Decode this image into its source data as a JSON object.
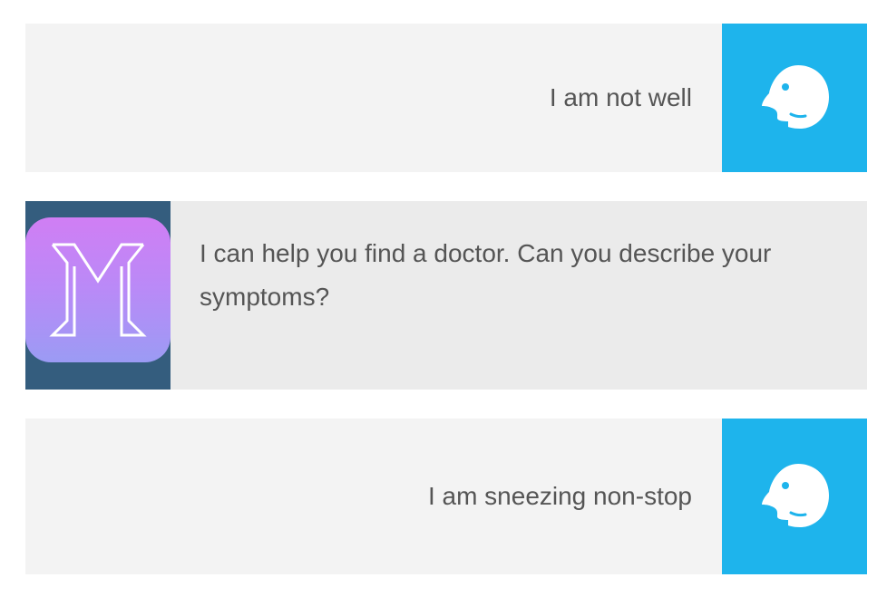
{
  "colors": {
    "user_avatar_bg": "#1eb4ec",
    "bot_avatar_bg": "#345d7e",
    "user_bubble_bg": "#f3f3f3",
    "bot_bubble_bg": "#ebebeb",
    "text": "#555555"
  },
  "messages": [
    {
      "sender": "user",
      "avatar_icon": "user-face-icon",
      "text": "I am not well"
    },
    {
      "sender": "bot",
      "avatar_icon": "m-logo-icon",
      "text": "I can help you find a doctor. Can you describe your symptoms?"
    },
    {
      "sender": "user",
      "avatar_icon": "user-face-icon",
      "text": "I am sneezing non-stop"
    }
  ]
}
